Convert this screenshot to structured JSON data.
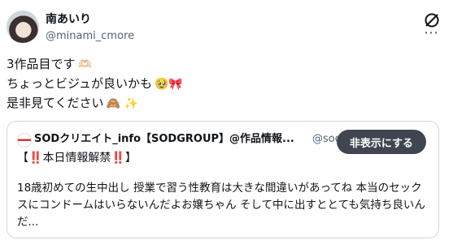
{
  "author": {
    "display_name": "南あいり",
    "handle": "@minami_cmore"
  },
  "tweet": {
    "lines": [
      {
        "text": "3作品目です",
        "emoji": "🫶🏻"
      },
      {
        "text": "ちょっとビジュが良いかも",
        "emoji": "🥹🎀"
      },
      {
        "text": "是非見てください",
        "emoji": "🙈 ✨"
      }
    ]
  },
  "quote": {
    "display_name": "SODクリエイト_info【SODGROUP】@作品情報...",
    "handle": "@sod",
    "hide_button_label": "非表示にする",
    "tag_open": "【",
    "tag_bang": "‼️",
    "tag_text": "本日情報解禁",
    "tag_close": "】",
    "body": "18歳初めての生中出し 授業で習う性教育は大きな間違いがあってね 本当のセックスにコンドームはいらないんだよお嬢ちゃん そして中に出すととても気持ち良いんだ..."
  },
  "icons": {
    "grok": "grok-icon",
    "more": "more-icon"
  }
}
